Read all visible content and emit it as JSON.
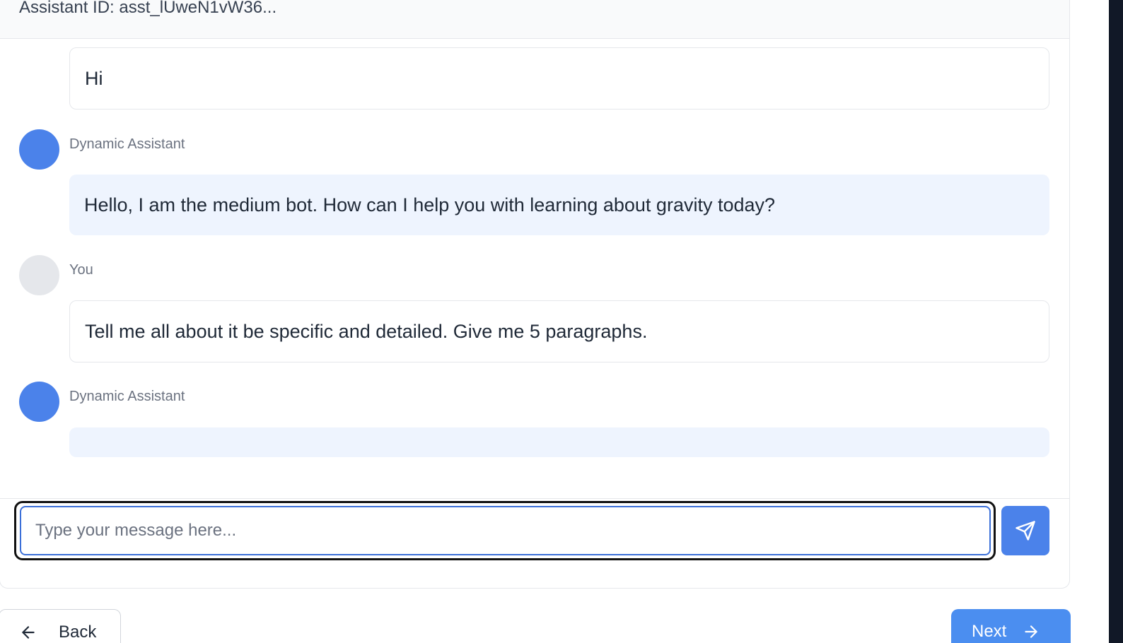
{
  "header": {
    "assistant_id": "Assistant ID: asst_lUweN1vW36..."
  },
  "messages": [
    {
      "role": "user",
      "sender": "",
      "text": "Hi"
    },
    {
      "role": "assistant",
      "sender": "Dynamic Assistant",
      "text": "Hello, I am the medium bot. How can I help you with learning about gravity today?"
    },
    {
      "role": "user",
      "sender": "You",
      "text": "Tell me all about it be specific and detailed. Give me 5 paragraphs."
    },
    {
      "role": "assistant",
      "sender": "Dynamic Assistant",
      "text": ""
    }
  ],
  "composer": {
    "placeholder": "Type your message here...",
    "value": "",
    "send_icon": "send-icon"
  },
  "navigation": {
    "back_label": "Back",
    "back_icon": "arrow-left-icon",
    "next_label": "Next",
    "next_icon": "arrow-right-icon"
  },
  "colors": {
    "accent": "#4b82ea",
    "assistant_bubble": "#eef4fe",
    "user_avatar": "#e5e7eb",
    "next_button": "#4b8ef0"
  }
}
